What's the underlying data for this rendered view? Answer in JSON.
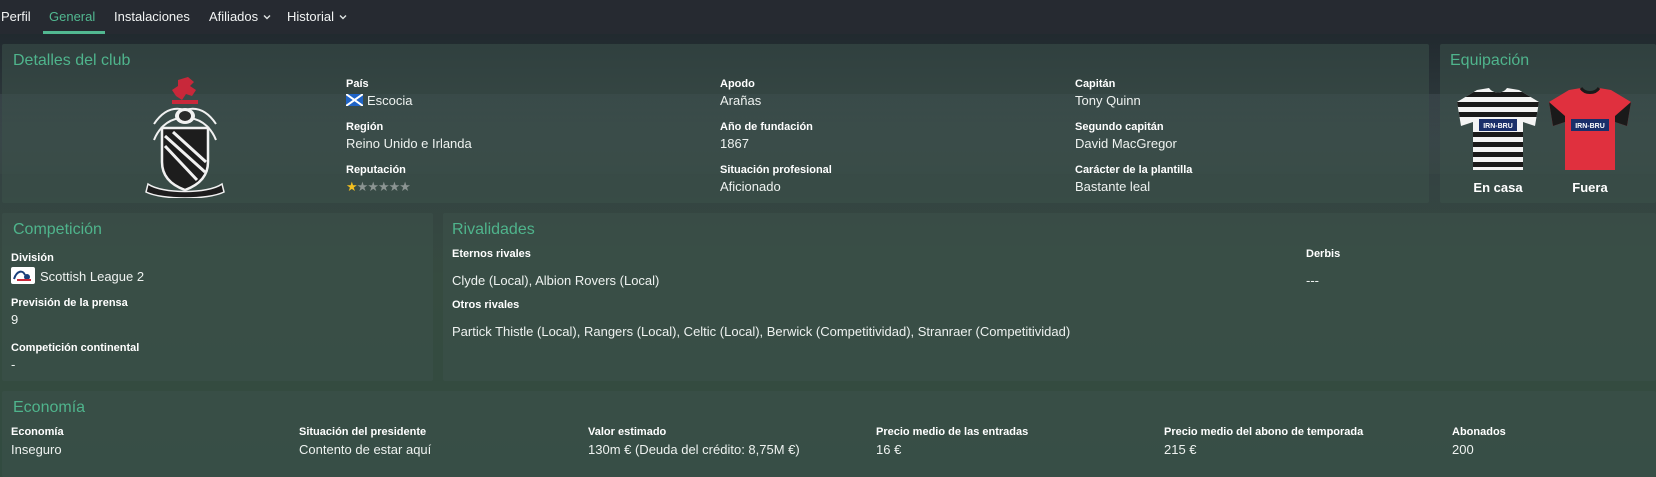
{
  "tabs": [
    {
      "label": "Perfil"
    },
    {
      "label": "General"
    },
    {
      "label": "Instalaciones"
    },
    {
      "label": "Afiliados"
    },
    {
      "label": "Historial"
    }
  ],
  "active_tab": "General",
  "club_details": {
    "title": "Detalles del club",
    "pais": {
      "label": "País",
      "value": "Escocia"
    },
    "region": {
      "label": "Región",
      "value": "Reino Unido e Irlanda"
    },
    "reputacion": {
      "label": "Reputación",
      "stars_filled": 1,
      "stars_total": 6
    },
    "apodo": {
      "label": "Apodo",
      "value": "Arañas"
    },
    "fundacion": {
      "label": "Año de fundación",
      "value": "1867"
    },
    "situacion": {
      "label": "Situación profesional",
      "value": "Aficionado"
    },
    "capitan": {
      "label": "Capitán",
      "value": "Tony Quinn"
    },
    "segundo_capitan": {
      "label": "Segundo capitán",
      "value": "David MacGregor"
    },
    "caracter": {
      "label": "Carácter de la plantilla",
      "value": "Bastante leal"
    }
  },
  "kits": {
    "title": "Equipación",
    "home_label": "En casa",
    "away_label": "Fuera",
    "sponsor": "IRN-BRU",
    "home_colors": [
      "#1a1a1a",
      "#f4f4f4"
    ],
    "away_color": "#e0303e"
  },
  "competition": {
    "title": "Competición",
    "division": {
      "label": "División",
      "value": "Scottish League 2"
    },
    "prevision": {
      "label": "Previsión de la prensa",
      "value": "9"
    },
    "continental": {
      "label": "Competición continental",
      "value": "-"
    }
  },
  "rivalries": {
    "title": "Rivalidades",
    "eternos": {
      "label": "Eternos rivales",
      "value": "Clyde (Local), Albion Rovers (Local)"
    },
    "derbis": {
      "label": "Derbis",
      "value": "---"
    },
    "otros": {
      "label": "Otros rivales",
      "value": "Partick Thistle (Local), Rangers (Local), Celtic (Local), Berwick (Competitividad), Stranraer (Competitividad)"
    }
  },
  "economy": {
    "title": "Economía",
    "items": [
      {
        "label": "Economía",
        "value": "Inseguro"
      },
      {
        "label": "Situación del presidente",
        "value": "Contento de estar aquí"
      },
      {
        "label": "Valor estimado",
        "value": "130m € (Deuda del crédito: 8,75M €)"
      },
      {
        "label": "Precio medio de las entradas",
        "value": "16 €"
      },
      {
        "label": "Precio medio del abono de temporada",
        "value": "215 €"
      },
      {
        "label": "Abonados",
        "value": "200"
      }
    ]
  },
  "colors": {
    "accent": "#52b891",
    "star": "#f3c020"
  },
  "icons": [
    "chevron-down-icon",
    "scotland-flag-icon",
    "club-crest-icon",
    "league-logo-icon",
    "home-kit-icon",
    "away-kit-icon",
    "star-icon"
  ]
}
